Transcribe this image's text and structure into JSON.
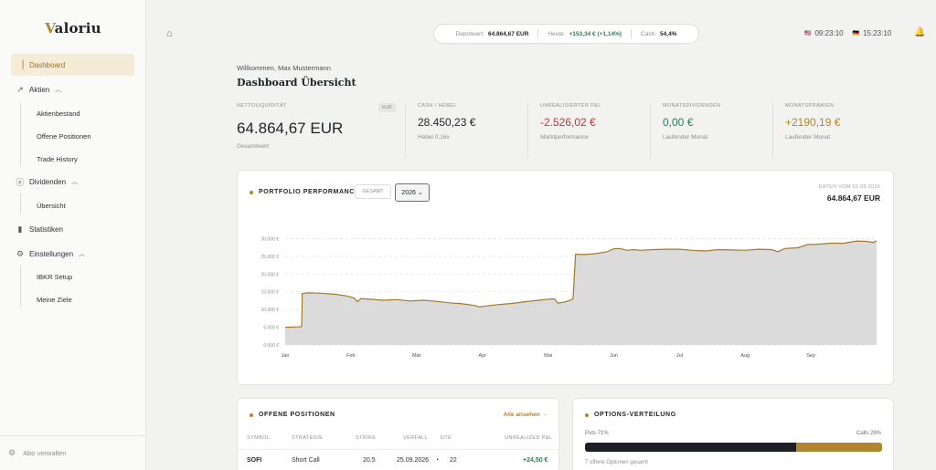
{
  "app": {
    "logo_initial": "V",
    "logo_rest": "aloriu"
  },
  "sidebar": {
    "dashboard": "Dashboard",
    "aktien": "Aktien",
    "aktien_sub": [
      "Aktienbestand",
      "Offene Positionen",
      "Trade History"
    ],
    "dividenden": "Dividenden",
    "dividenden_sub": [
      "Übersicht"
    ],
    "statistiken": "Statistiken",
    "einstellungen": "Einstellungen",
    "einstellungen_sub": [
      "IBKR Setup",
      "Meine Ziele"
    ],
    "footer": "Abo verwalten"
  },
  "topbar": {
    "depot_label": "Depotwert:",
    "depot_value": "64.864,67 EUR",
    "heute_label": "Heute:",
    "heute_value": "+153,34 € (+1,14%)",
    "cash_label": "Cash:",
    "cash_value": "54,4%",
    "clock_us": "09:23:10",
    "clock_de": "15:23:10"
  },
  "header": {
    "welcome": "Willkommen, Max Mustermann",
    "title": "Dashboard Übersicht"
  },
  "kpis": {
    "netto": {
      "label": "Nettoliquidität",
      "badge": "EUR",
      "value": "64.864,67 EUR",
      "sub": "Gesamtwert"
    },
    "cash": {
      "label": "Cash / Hebel",
      "value": "28.450,23 €",
      "sub": "Hebel 0,16x"
    },
    "unrealized": {
      "label": "Unrealisierter P&L",
      "value": "-2.526,02 €",
      "sub": "Marktperformance"
    },
    "dividenden": {
      "label": "Monatsdividenden",
      "value": "0,00 €",
      "sub": "Laufender Monat"
    },
    "praemien": {
      "label": "Monatsprämien",
      "value": "+2190,19 €",
      "sub": "Laufender Monat"
    }
  },
  "performance": {
    "title": "PORTFOLIO PERFORMANCE",
    "btn_gesamt": "GESAMT",
    "year": "2026",
    "data_date": "Daten vom 02.09.2026",
    "data_value": "64.864,67 EUR"
  },
  "chart_data": {
    "type": "area",
    "title": "",
    "xlabel": "",
    "ylabel": "",
    "ylim": [
      0,
      35000
    ],
    "y_ticks": [
      0,
      5000,
      10000,
      15000,
      20000,
      25000,
      30000
    ],
    "y_tick_labels": [
      "0.000 €",
      "5.000 €",
      "10.000 €",
      "15.000 €",
      "20.000 €",
      "25.000 €",
      "30.000 €"
    ],
    "x_tick_labels": [
      "Jan",
      "Feb",
      "Mär",
      "Apr",
      "Mai",
      "Jun",
      "Jul",
      "Aug",
      "Sep"
    ],
    "x_tick_months": [
      0,
      1,
      2,
      3,
      4,
      5,
      6,
      7,
      8
    ],
    "grid": true,
    "color": "#a37a2c",
    "fill": "#d9d9d9",
    "series": [
      {
        "values": [
          [
            0.0,
            5000
          ],
          [
            0.2,
            5100
          ],
          [
            0.25,
            5200
          ],
          [
            0.26,
            14500
          ],
          [
            0.35,
            14700
          ],
          [
            0.55,
            14600
          ],
          [
            0.75,
            14300
          ],
          [
            0.95,
            13800
          ],
          [
            1.05,
            13200
          ],
          [
            1.1,
            12200
          ],
          [
            1.15,
            13100
          ],
          [
            1.3,
            12900
          ],
          [
            1.5,
            12600
          ],
          [
            1.7,
            12800
          ],
          [
            1.9,
            12400
          ],
          [
            2.1,
            12600
          ],
          [
            2.3,
            12300
          ],
          [
            2.5,
            11900
          ],
          [
            2.7,
            11600
          ],
          [
            2.9,
            11100
          ],
          [
            2.95,
            10700
          ],
          [
            3.05,
            11000
          ],
          [
            3.25,
            11400
          ],
          [
            3.45,
            11700
          ],
          [
            3.65,
            12200
          ],
          [
            3.85,
            12600
          ],
          [
            4.0,
            12900
          ],
          [
            4.1,
            13000
          ],
          [
            4.15,
            11800
          ],
          [
            4.25,
            12100
          ],
          [
            4.35,
            12700
          ],
          [
            4.38,
            13000
          ],
          [
            4.42,
            25600
          ],
          [
            4.55,
            25500
          ],
          [
            4.7,
            25700
          ],
          [
            4.9,
            26300
          ],
          [
            5.0,
            27100
          ],
          [
            5.1,
            27200
          ],
          [
            5.2,
            26700
          ],
          [
            5.3,
            26900
          ],
          [
            5.4,
            26700
          ],
          [
            5.6,
            26900
          ],
          [
            5.8,
            27000
          ],
          [
            6.0,
            27000
          ],
          [
            6.2,
            26700
          ],
          [
            6.4,
            26500
          ],
          [
            6.6,
            26900
          ],
          [
            6.8,
            26800
          ],
          [
            7.0,
            26700
          ],
          [
            7.2,
            27000
          ],
          [
            7.4,
            26900
          ],
          [
            7.5,
            26300
          ],
          [
            7.6,
            27200
          ],
          [
            7.8,
            27400
          ],
          [
            7.95,
            28300
          ],
          [
            8.1,
            28400
          ],
          [
            8.3,
            28700
          ],
          [
            8.5,
            28700
          ],
          [
            8.7,
            29300
          ],
          [
            8.85,
            29200
          ],
          [
            8.95,
            28900
          ],
          [
            9.0,
            29400
          ]
        ]
      }
    ]
  },
  "positions": {
    "title": "OFFENE POSITIONEN",
    "link_all": "Alle ansehen →",
    "headers": [
      "SYMBOL",
      "STRATEGIE",
      "STRIKE",
      "VERFALL",
      "DTE",
      "UNREALIZED P&L"
    ],
    "row": {
      "symbol": "SOFI",
      "strategy": "Short Call",
      "strike": "20.5",
      "expiry": "25.09.2026",
      "dte": "22",
      "pnl": "+24,50 €"
    }
  },
  "options": {
    "title": "OPTIONS-VERTEILUNG",
    "puts_label": "Puts 71%",
    "calls_label": "Calls 29%",
    "puts_share": 0.71,
    "calls_share": 0.29,
    "footer": "7 offene Optionen gesamt"
  }
}
